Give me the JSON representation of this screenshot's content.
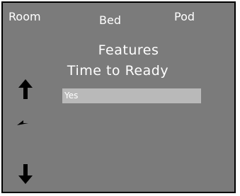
{
  "tabs": {
    "room": "Room",
    "bed": "Bed",
    "pod": "Pod"
  },
  "menu": {
    "title": "Features",
    "subtitle": "Time to Ready",
    "options": [
      {
        "label": "Yes",
        "selected": true
      }
    ]
  },
  "nav": {
    "up_icon": "arrow-up-icon",
    "back_icon": "return-arrow-icon",
    "down_icon": "arrow-down-icon"
  },
  "colors": {
    "screen_bg": "#7b7b7b",
    "highlight": "#b9b9b9",
    "text": "#ffffff",
    "icon": "#000000"
  }
}
